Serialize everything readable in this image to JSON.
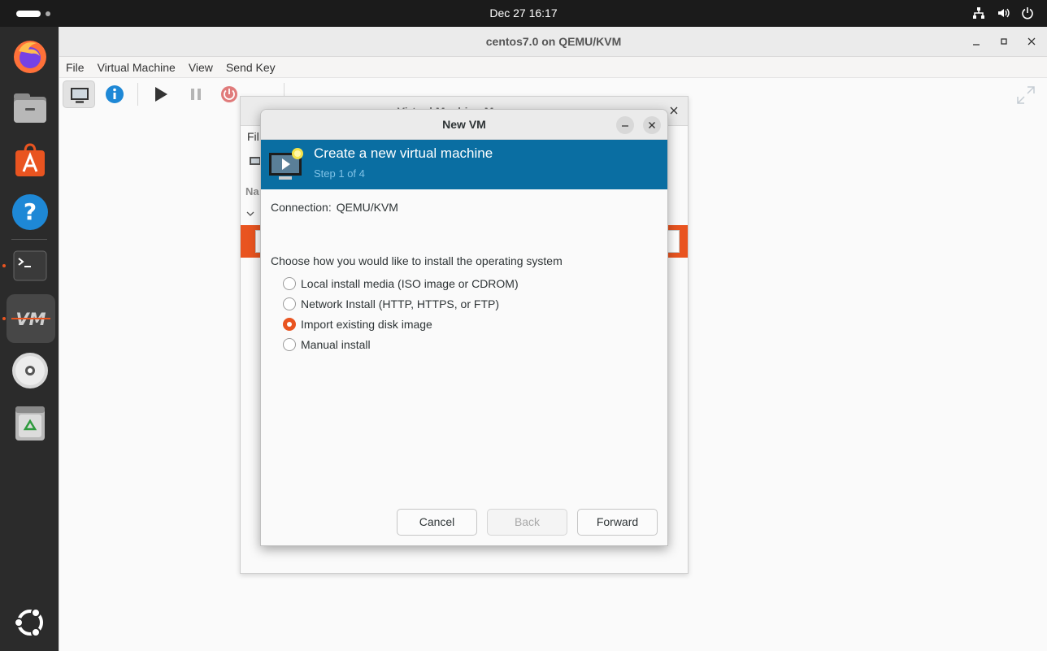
{
  "topbar": {
    "clock": "Dec 27  16:17"
  },
  "dock": {
    "items": [
      "firefox-icon",
      "files-icon",
      "app-center-icon",
      "help-icon",
      "terminal-icon",
      "virt-manager-icon",
      "disc-icon",
      "trash-icon",
      "ubuntu-logo-icon"
    ]
  },
  "main_window": {
    "title": "centos7.0 on QEMU/KVM",
    "menu": [
      "File",
      "Virtual Machine",
      "View",
      "Send Key"
    ]
  },
  "manager_window": {
    "title": "Virtual Machine Manager",
    "menu_fragment": "Fil",
    "column_fragment": "Na"
  },
  "dialog": {
    "title": "New VM",
    "header": "Create a new virtual machine",
    "step": "Step 1 of 4",
    "connection_label": "Connection:",
    "connection_value": "QEMU/KVM",
    "prompt": "Choose how you would like to install the operating system",
    "options": [
      {
        "label": "Local install media (ISO image or CDROM)",
        "selected": false
      },
      {
        "label": "Network Install (HTTP, HTTPS, or FTP)",
        "selected": false
      },
      {
        "label": "Import existing disk image",
        "selected": true
      },
      {
        "label": "Manual install",
        "selected": false
      }
    ],
    "buttons": {
      "cancel": "Cancel",
      "back": "Back",
      "forward": "Forward"
    }
  },
  "colors": {
    "accent": "#e95420",
    "banner": "#0a6ea2",
    "topbar": "#1b1b1b",
    "dock": "#2b2b2b"
  }
}
